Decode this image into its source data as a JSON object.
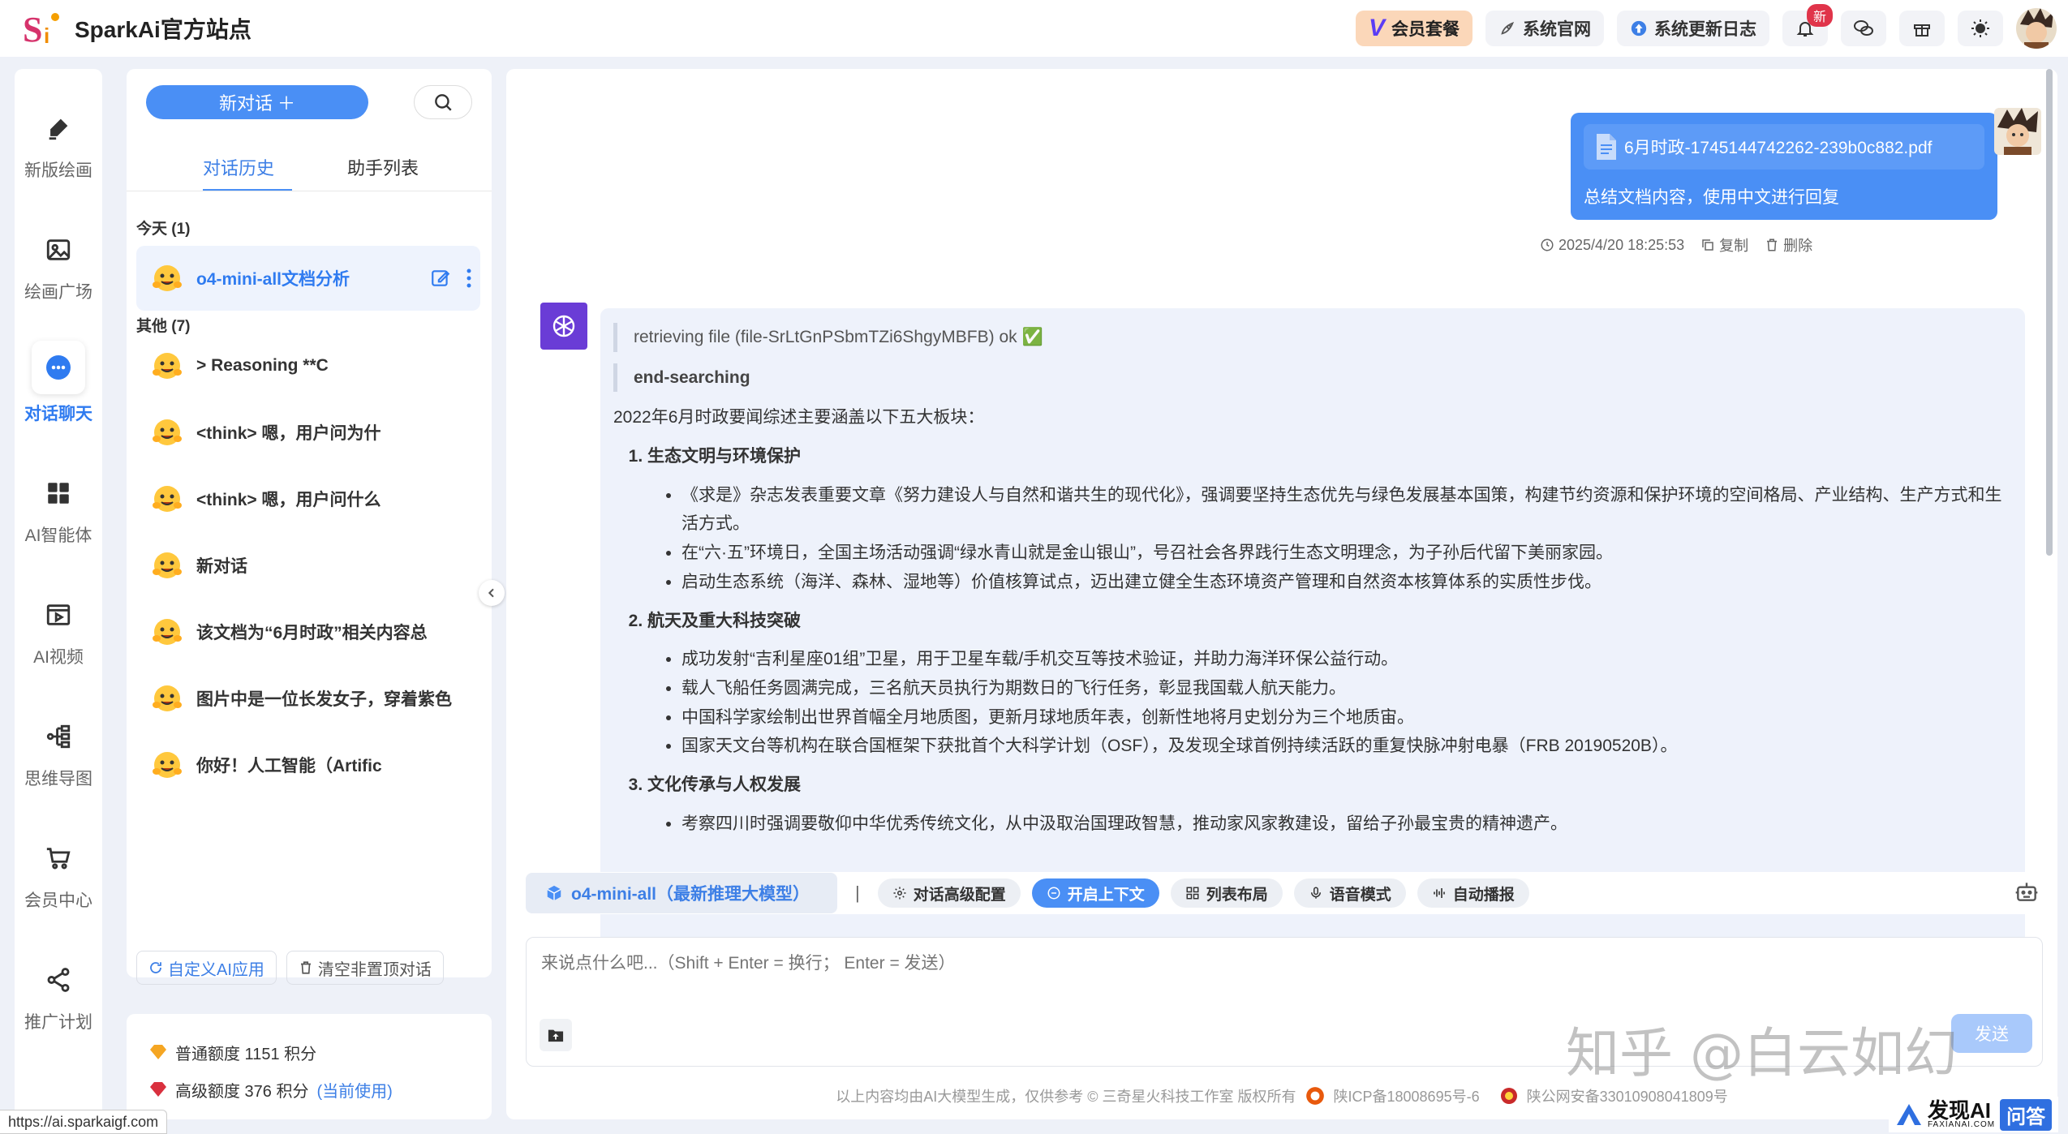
{
  "app": {
    "title": "SparkAi官方站点"
  },
  "topbar": {
    "vip_label": "会员套餐",
    "site_label": "系统官网",
    "changelog_label": "系统更新日志",
    "notify_badge": "新"
  },
  "nav": [
    {
      "label": "新版绘画",
      "icon": "brush-icon"
    },
    {
      "label": "绘画广场",
      "icon": "image-icon"
    },
    {
      "label": "对话聊天",
      "icon": "chat-icon"
    },
    {
      "label": "AI智能体",
      "icon": "grid-icon"
    },
    {
      "label": "AI视频",
      "icon": "video-icon"
    },
    {
      "label": "思维导图",
      "icon": "mindmap-icon"
    },
    {
      "label": "会员中心",
      "icon": "cart-icon"
    },
    {
      "label": "推广计划",
      "icon": "share-icon"
    }
  ],
  "sidebar": {
    "new_chat": "新对话 ＋",
    "tab_history": "对话历史",
    "tab_assistants": "助手列表",
    "group_today": "今天 (1)",
    "group_other": "其他 (7)",
    "today": [
      {
        "title": "o4-mini-all文档分析"
      }
    ],
    "others": [
      {
        "title": "> Reasoning **C"
      },
      {
        "title": "<think> 嗯，用户问为什"
      },
      {
        "title": "<think> 嗯，用户问什么"
      },
      {
        "title": "新对话"
      },
      {
        "title": "该文档为“6月时政”相关内容总"
      },
      {
        "title": "图片中是一位长发女子，穿着紫色"
      },
      {
        "title": "你好！人工智能（Artific"
      }
    ],
    "custom_app": "自定义AI应用",
    "clear_label": "清空非置顶对话"
  },
  "quota": {
    "normal": "普通额度 1151 积分",
    "advanced": "高级额度 376 积分",
    "current": "(当前使用)"
  },
  "chat": {
    "file_name": "6月时政-1745144742262-239b0c882.pdf",
    "user_text": "总结文档内容，使用中文进行回复",
    "timestamp": "2025/4/20 18:25:53",
    "copy": "复制",
    "delete": "删除",
    "quote1": "retrieving file (file-SrLtGnPSbmTZi6ShgyMBFB) ok ✅",
    "quote2": "end-searching",
    "intro": "2022年6月时政要闻综述主要涵盖以下五大板块：",
    "sections": [
      {
        "title": "生态文明与环境保护",
        "items": [
          "《求是》杂志发表重要文章《努力建设人与自然和谐共生的现代化》，强调要坚持生态优先与绿色发展基本国策，构建节约资源和保护环境的空间格局、产业结构、生产方式和生活方式。",
          "在“六·五”环境日，全国主场活动强调“绿水青山就是金山银山”，号召社会各界践行生态文明理念，为子孙后代留下美丽家园。",
          "启动生态系统（海洋、森林、湿地等）价值核算试点，迈出建立健全生态环境资产管理和自然资本核算体系的实质性步伐。"
        ]
      },
      {
        "title": "航天及重大科技突破",
        "items": [
          "成功发射“吉利星座01组”卫星，用于卫星车载/手机交互等技术验证，并助力海洋环保公益行动。",
          "载人飞船任务圆满完成，三名航天员执行为期数日的飞行任务，彰显我国载人航天能力。",
          "中国科学家绘制出世界首幅全月地质图，更新月球地质年表，创新性地将月史划分为三个地质宙。",
          "国家天文台等机构在联合国框架下获批首个大科学计划（OSF），及发现全球首例持续活跃的重复快脉冲射电暴（FRB 20190520B）。"
        ]
      },
      {
        "title": "文化传承与人权发展",
        "items": [
          "考察四川时强调要敬仰中华优秀传统文化，从中汲取治国理政智慧，推动家风家教建设，留给子孙最宝贵的精神遗产。"
        ]
      }
    ]
  },
  "toolbar": {
    "model": "o4-mini-all（最新推理大模型）",
    "sep": "|",
    "advanced": "对话高级配置",
    "context": "开启上下文",
    "layout": "列表布局",
    "voice": "语音模式",
    "autoplay": "自动播报"
  },
  "input": {
    "placeholder": "来说点什么吧...（Shift + Enter = 换行； Enter = 发送）",
    "send": "发送"
  },
  "footer": {
    "disclaimer": "以上内容均由AI大模型生成，仅供参考 © 三奇星火科技工作室 版权所有",
    "icp": "陕ICP备18008695号-6",
    "police": "陕公网安备33010908041809号"
  },
  "watermark": "知乎 @白云如幻",
  "brand_badge": {
    "name": "发现AI",
    "sub": "FAXIANAI.COM",
    "tag": "问答"
  },
  "status_url": "https://ai.sparkaigf.com",
  "colors": {
    "accent": "#4a8ff5",
    "accent_text": "#2f7bf0",
    "vip_bg": "#fbd7b9",
    "badge": "#e0344a",
    "bot_avatar": "#6a3cd6"
  }
}
